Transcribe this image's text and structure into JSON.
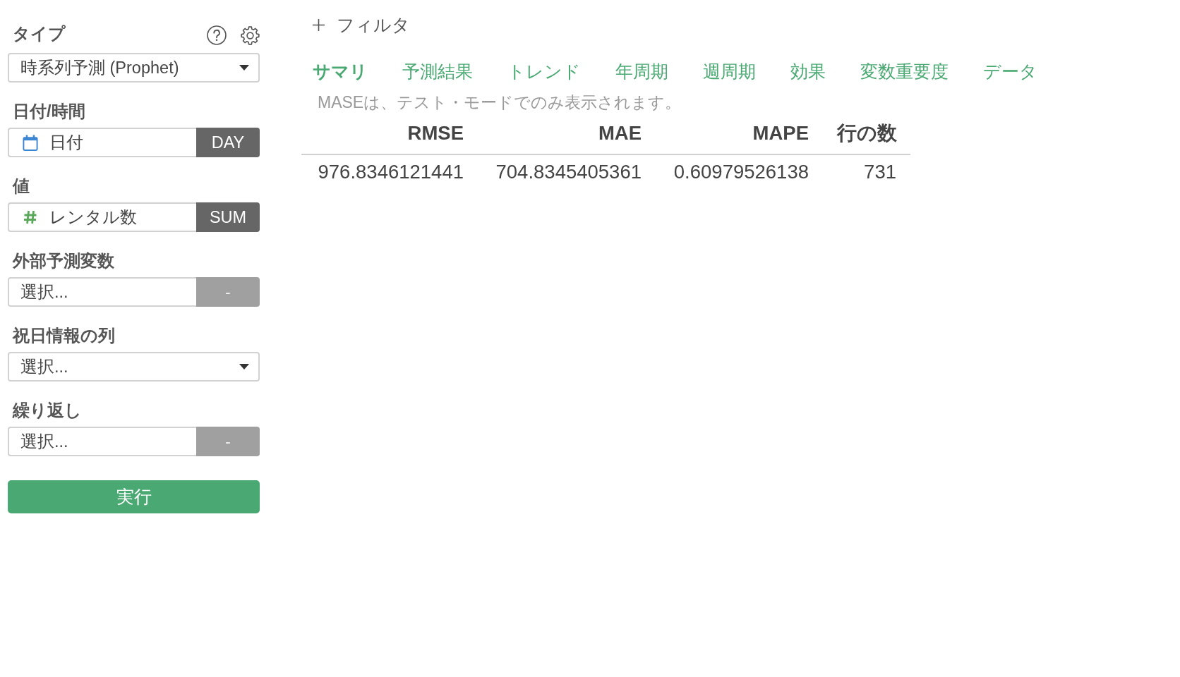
{
  "sidebar": {
    "type_field": {
      "label": "タイプ",
      "value": "時系列予測 (Prophet)"
    },
    "fields": [
      {
        "label": "日付/時間",
        "kind": "date_column",
        "column": "日付",
        "button": {
          "label": "DAY",
          "disabled": false
        }
      },
      {
        "label": "値",
        "kind": "number_column",
        "column": "レンタル数",
        "button": {
          "label": "SUM",
          "disabled": false
        }
      },
      {
        "label": "外部予測変数",
        "kind": "column",
        "placeholder": "選択...",
        "button": {
          "label": "-",
          "disabled": true
        }
      },
      {
        "label": "祝日情報の列",
        "kind": "select",
        "placeholder": "選択..."
      },
      {
        "label": "繰り返し",
        "kind": "column",
        "placeholder": "選択...",
        "button": {
          "label": "-",
          "disabled": true
        }
      }
    ],
    "run_button": {
      "label": "実行"
    }
  },
  "main": {
    "filter_button": {
      "label": "フィルタ"
    },
    "tabs": [
      {
        "label": "サマリ",
        "selected": true
      },
      {
        "label": "予測結果",
        "selected": false
      },
      {
        "label": "トレンド",
        "selected": false
      },
      {
        "label": "年周期",
        "selected": false
      },
      {
        "label": "週周期",
        "selected": false
      },
      {
        "label": "効果",
        "selected": false
      },
      {
        "label": "変数重要度",
        "selected": false
      },
      {
        "label": "データ",
        "selected": false
      }
    ],
    "note": "MASEは、テスト・モードでのみ表示されます。",
    "table": {
      "columns": [
        "RMSE",
        "MAE",
        "MAPE",
        "行の数"
      ],
      "rows": [
        [
          "976.8346121441",
          "704.8345405361",
          "0.60979526138",
          "731"
        ]
      ]
    }
  }
}
